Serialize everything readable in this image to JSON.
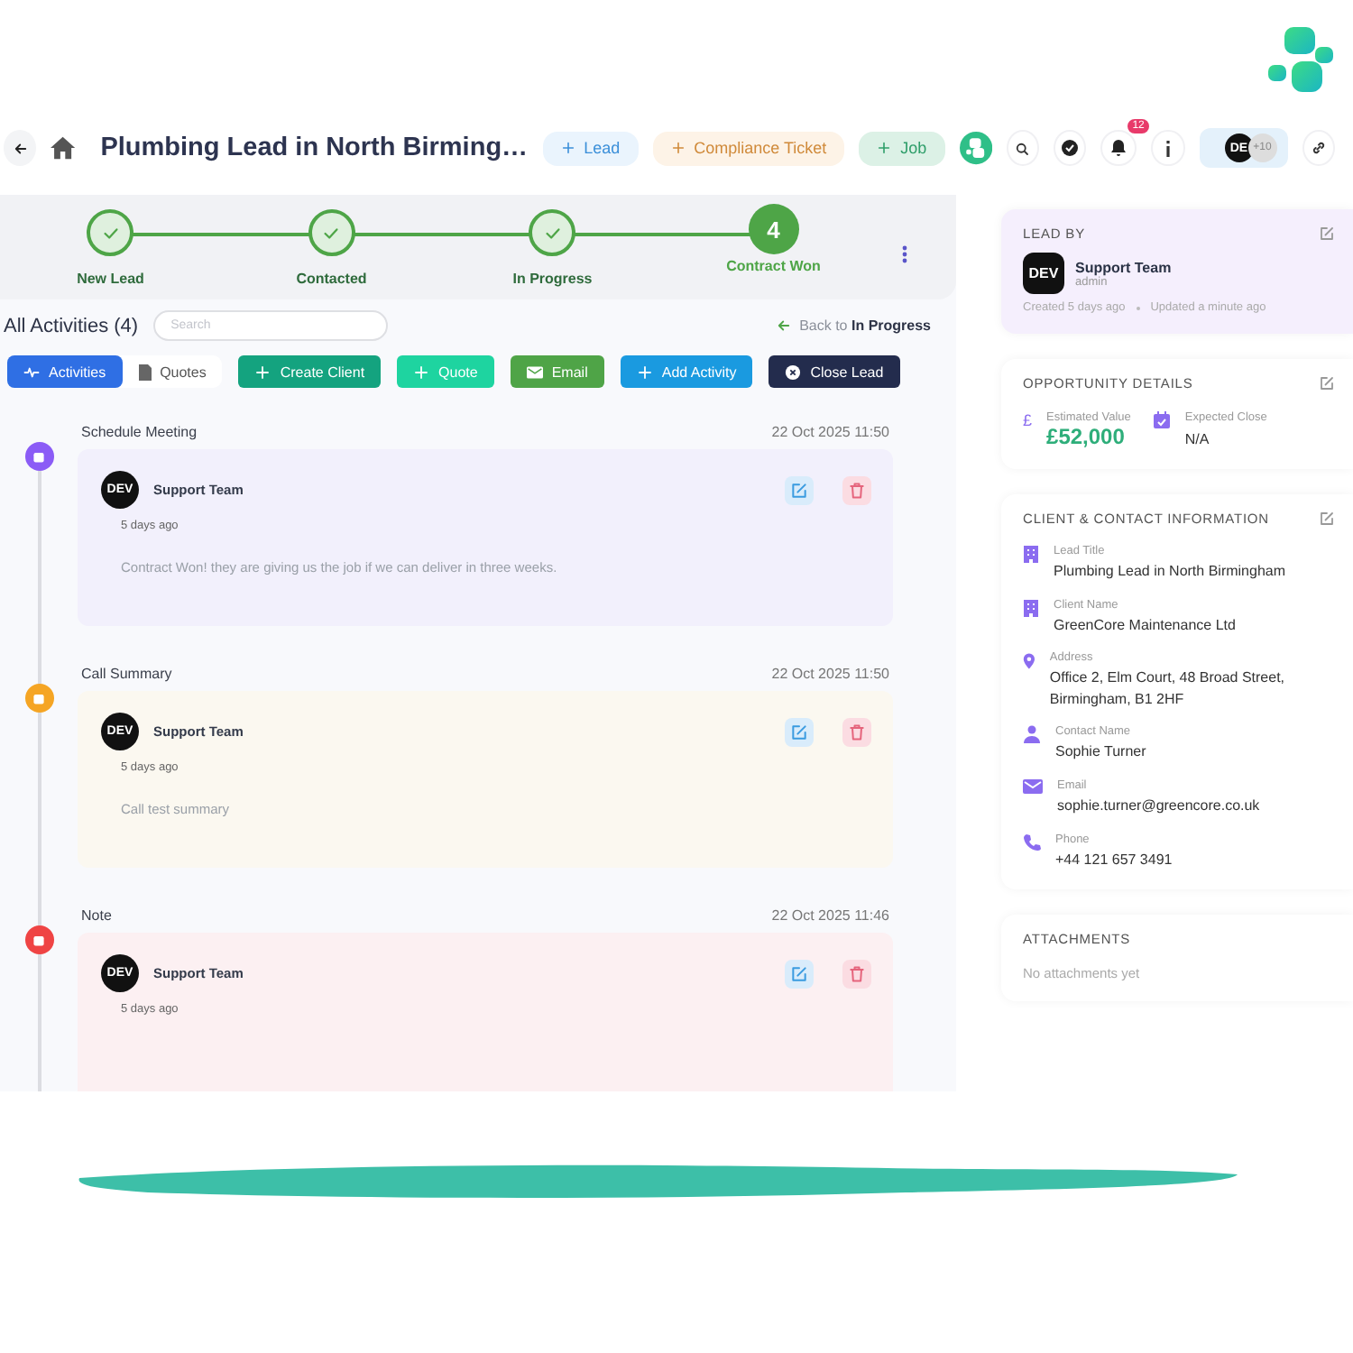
{
  "header": {
    "title": "Plumbing Lead in North Birming…",
    "quick_actions": [
      {
        "label": "Lead",
        "kind": "lead"
      },
      {
        "label": "Compliance Ticket",
        "kind": "compliance"
      },
      {
        "label": "Job",
        "kind": "job"
      }
    ],
    "notification_count": "12",
    "avatar": "DE",
    "more_users": "+10"
  },
  "stepper": {
    "steps": [
      {
        "label": "New Lead",
        "completed": true
      },
      {
        "label": "Contacted",
        "completed": true
      },
      {
        "label": "In Progress",
        "completed": true
      },
      {
        "label": "Contract Won",
        "completed": false,
        "number": "4"
      }
    ]
  },
  "activities": {
    "title": "All Activities (4)",
    "search": {
      "placeholder": "Search"
    },
    "back_link": {
      "prefix": "Back to",
      "stage": "In Progress"
    },
    "view_tabs": [
      {
        "label": "Activities",
        "selected": true
      },
      {
        "label": "Quotes",
        "selected": false
      }
    ],
    "actions": [
      {
        "label": "Create Client",
        "kind": "create"
      },
      {
        "label": "Quote",
        "kind": "quote"
      },
      {
        "label": "Email",
        "kind": "email"
      },
      {
        "label": "Add Activity",
        "kind": "add"
      },
      {
        "label": "Close Lead",
        "kind": "close"
      }
    ],
    "items": [
      {
        "kind": "meeting",
        "title": "Schedule Meeting",
        "time": "22 Oct 2025 11:50",
        "avatar": "DEV",
        "author": "Support Team",
        "ago": "5 days ago",
        "body": "Contract Won! they are giving us the job if we can deliver in three weeks."
      },
      {
        "kind": "call",
        "title": "Call Summary",
        "time": "22 Oct 2025 11:50",
        "avatar": "DEV",
        "author": "Support Team",
        "ago": "5 days ago",
        "body": "Call test summary"
      },
      {
        "kind": "note",
        "title": "Note",
        "time": "22 Oct 2025 11:46",
        "avatar": "DEV",
        "author": "Support Team",
        "ago": "5 days ago"
      }
    ]
  },
  "lead_by": {
    "heading": "LEAD BY",
    "avatar": "DEV",
    "name": "Support Team",
    "role": "admin",
    "created": "Created 5 days ago",
    "updated": "Updated a minute ago"
  },
  "opportunity": {
    "heading": "OPPORTUNITY DETAILS",
    "fields": [
      {
        "kind": "currency",
        "symbol": "£",
        "label": "Estimated Value",
        "value": "£52,000"
      },
      {
        "kind": "date",
        "label": "Expected Close",
        "value": "N/A"
      }
    ]
  },
  "client_info": {
    "heading": "CLIENT & CONTACT INFORMATION",
    "fields": [
      {
        "kind": "building",
        "label": "Lead Title",
        "value": "Plumbing Lead in North Birmingham"
      },
      {
        "kind": "building",
        "label": "Client Name",
        "value": "GreenCore Maintenance Ltd"
      },
      {
        "kind": "pin",
        "label": "Address",
        "value": "Office 2, Elm Court, 48 Broad Street, Birmingham, B1 2HF"
      },
      {
        "kind": "person",
        "label": "Contact Name",
        "value": "Sophie Turner"
      },
      {
        "kind": "mail",
        "label": "Email",
        "value": "sophie.turner@greencore.co.uk"
      },
      {
        "kind": "phone",
        "label": "Phone",
        "value": "+44 121 657 3491"
      }
    ]
  },
  "attachments": {
    "heading": "ATTACHMENTS",
    "empty": "No attachments yet"
  }
}
